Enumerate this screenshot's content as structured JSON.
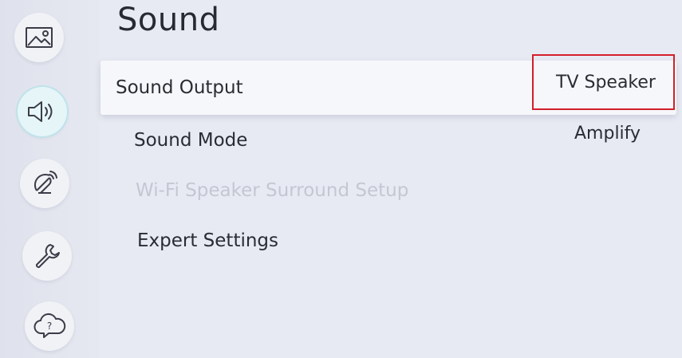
{
  "page": {
    "title": "Sound"
  },
  "sidebar": {
    "items": [
      {
        "icon": "picture-icon"
      },
      {
        "icon": "sound-icon",
        "active": true
      },
      {
        "icon": "broadcast-icon"
      },
      {
        "icon": "wrench-icon"
      },
      {
        "icon": "support-cloud-icon"
      }
    ]
  },
  "menu": {
    "items": [
      {
        "label": "Sound Output",
        "value": "TV Speaker",
        "selected": true
      },
      {
        "label": "Sound Mode",
        "value": "Amplify"
      },
      {
        "label": "Wi-Fi Speaker Surround Setup",
        "disabled": true
      },
      {
        "label": "Expert Settings"
      }
    ]
  },
  "colors": {
    "highlight_border": "#d21f2b",
    "background": "#e8eaf3",
    "disabled_text": "#c4c7d2"
  }
}
